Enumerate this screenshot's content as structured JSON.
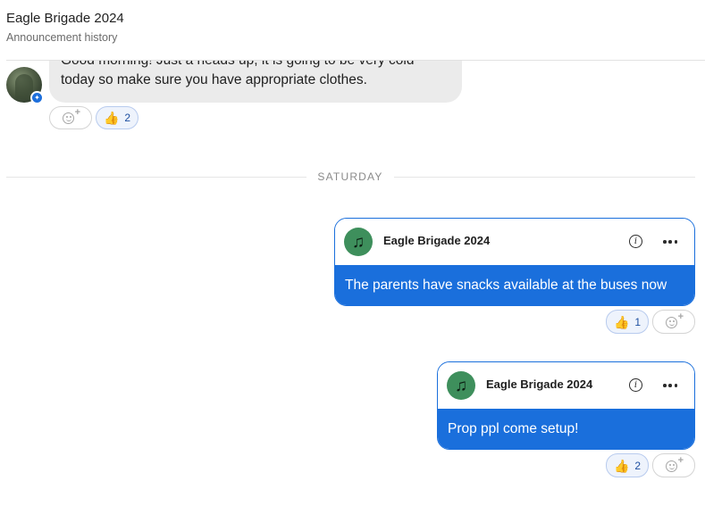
{
  "header": {
    "title": "Eagle Brigade 2024",
    "subtitle": "Announcement history"
  },
  "incoming_message": {
    "text": "Good morning! Just a heads up, it is going to be very cold today so make sure you have appropriate clothes.",
    "reactions": {
      "thumbs_up_count": "2"
    }
  },
  "separator": {
    "label": "SATURDAY"
  },
  "announcements": [
    {
      "sender": "Eagle Brigade 2024",
      "text": "The parents have snacks available at the buses now",
      "thumbs_up_count": "1"
    },
    {
      "sender": "Eagle Brigade 2024",
      "text": "Prop ppl come setup!",
      "thumbs_up_count": "2"
    }
  ],
  "icons": {
    "reaction": "thumbs-up-icon",
    "add_reaction": "add-reaction-icon",
    "info": "info-icon",
    "more": "more-options-icon",
    "group_avatar": "music-note-icon",
    "verified": "verified-badge-icon"
  },
  "colors": {
    "accent": "#1a6fdc",
    "group_avatar_bg": "#3e8f5c",
    "incoming_bubble": "#ebebeb"
  }
}
